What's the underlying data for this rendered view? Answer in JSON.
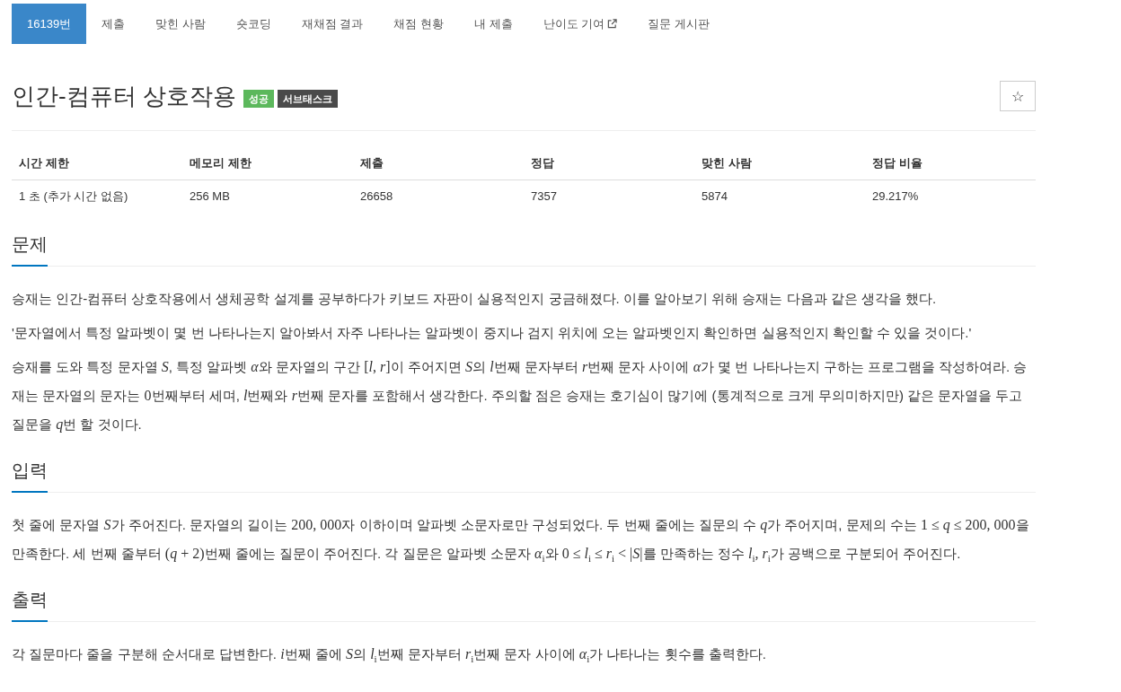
{
  "tabs": [
    {
      "label": "16139번",
      "selected": true,
      "external": false
    },
    {
      "label": "제출",
      "selected": false,
      "external": false
    },
    {
      "label": "맞힌 사람",
      "selected": false,
      "external": false
    },
    {
      "label": "숏코딩",
      "selected": false,
      "external": false
    },
    {
      "label": "재채점 결과",
      "selected": false,
      "external": false
    },
    {
      "label": "채점 현황",
      "selected": false,
      "external": false
    },
    {
      "label": "내 제출",
      "selected": false,
      "external": false
    },
    {
      "label": "난이도 기여",
      "selected": false,
      "external": true
    },
    {
      "label": "질문 게시판",
      "selected": false,
      "external": false
    }
  ],
  "title": "인간-컴퓨터 상호작용",
  "badges": [
    {
      "label": "성공",
      "kind": "success"
    },
    {
      "label": "서브태스크",
      "kind": "subtask"
    }
  ],
  "star_button": {
    "label": "☆"
  },
  "info_table": {
    "columns": [
      "시간 제한",
      "메모리 제한",
      "제출",
      "정답",
      "맞힌 사람",
      "정답 비율"
    ],
    "rows": [
      [
        "1 초 (추가 시간 없음)",
        "256 MB",
        "26658",
        "7357",
        "5874",
        "29.217%"
      ]
    ]
  },
  "sections": [
    {
      "heading": "문제",
      "paragraphs": [
        [
          {
            "kind": "text",
            "text": "승재는 인간-컴퓨터 상호작용에서 생체공학 설계를 공부하다가 키보드 자판이 실용적인지 궁금해졌다. 이를 알아보기 위해 승재는 다음과 같은 생각을 했다."
          }
        ],
        [
          {
            "kind": "text",
            "text": "'문자열에서 특정 알파벳이 몇 번 나타나는지 알아봐서 자주 나타나는 알파벳이 중지나 검지 위치에 오는 알파벳인지 확인하면 실용적인지 확인할 수 있을 것이다.'"
          }
        ],
        [
          {
            "kind": "text",
            "text": "승재를 도와 특정 문자열 "
          },
          {
            "kind": "math",
            "text": "*S*"
          },
          {
            "kind": "text",
            "text": ", 특정 알파벳 "
          },
          {
            "kind": "math",
            "text": "*α*"
          },
          {
            "kind": "text",
            "text": "와 문자열의 구간 "
          },
          {
            "kind": "math",
            "text": "[*l*, *r*]"
          },
          {
            "kind": "text",
            "text": "이 주어지면 "
          },
          {
            "kind": "math",
            "text": "*S*"
          },
          {
            "kind": "text",
            "text": "의 "
          },
          {
            "kind": "math",
            "text": "*l*"
          },
          {
            "kind": "text",
            "text": "번째 문자부터 "
          },
          {
            "kind": "math",
            "text": "*r*"
          },
          {
            "kind": "text",
            "text": "번째 문자 사이에 "
          },
          {
            "kind": "math",
            "text": "*α*"
          },
          {
            "kind": "text",
            "text": "가 몇 번 나타나는지 구하는 프로그램을 작성하여라. 승재는 문자열의 문자는 "
          },
          {
            "kind": "math",
            "text": "0"
          },
          {
            "kind": "text",
            "text": "번째부터 세며, "
          },
          {
            "kind": "math",
            "text": "*l*"
          },
          {
            "kind": "text",
            "text": "번째와 "
          },
          {
            "kind": "math",
            "text": "*r*"
          },
          {
            "kind": "text",
            "text": "번째 문자를 포함해서 생각한다. 주의할 점은 승재는 호기심이 많기에 (통계적으로 크게 무의미하지만) 같은 문자열을 두고 질문을 "
          },
          {
            "kind": "math",
            "text": "*q*"
          },
          {
            "kind": "text",
            "text": "번 할 것이다."
          }
        ]
      ]
    },
    {
      "heading": "입력",
      "paragraphs": [
        [
          {
            "kind": "text",
            "text": "첫 줄에 문자열 "
          },
          {
            "kind": "math",
            "text": "*S*"
          },
          {
            "kind": "text",
            "text": "가 주어진다. 문자열의 길이는 "
          },
          {
            "kind": "math",
            "text": "200, 000"
          },
          {
            "kind": "text",
            "text": "자 이하이며 알파벳 소문자로만 구성되었다. 두 번째 줄에는 질문의 수 "
          },
          {
            "kind": "math",
            "text": "*q*"
          },
          {
            "kind": "text",
            "text": "가 주어지며, 문제의 수는 "
          },
          {
            "kind": "math",
            "text": "1 ≤ *q* ≤ 200, 000"
          },
          {
            "kind": "text",
            "text": "을 만족한다. 세 번째 줄부터 "
          },
          {
            "kind": "math",
            "text": "(*q* + 2)"
          },
          {
            "kind": "text",
            "text": "번째 줄에는 질문이 주어진다. 각 질문은 알파벳 소문자 "
          },
          {
            "kind": "math",
            "text": "*α*$_{i}$"
          },
          {
            "kind": "text",
            "text": "와 "
          },
          {
            "kind": "math",
            "text": "0 ≤ *l*$_{i}$ ≤ *r*$_{i}$ < |*S*|"
          },
          {
            "kind": "text",
            "text": "를 만족하는 정수 "
          },
          {
            "kind": "math",
            "text": "*l*$_{i}$, *r*$_{i}$"
          },
          {
            "kind": "text",
            "text": "가 공백으로 구분되어 주어진다."
          }
        ]
      ]
    },
    {
      "heading": "출력",
      "paragraphs": [
        [
          {
            "kind": "text",
            "text": "각 질문마다 줄을 구분해 순서대로 답변한다. "
          },
          {
            "kind": "math",
            "text": "*i*"
          },
          {
            "kind": "text",
            "text": "번째 줄에 "
          },
          {
            "kind": "math",
            "text": "*S*"
          },
          {
            "kind": "text",
            "text": "의 "
          },
          {
            "kind": "math",
            "text": "*l*$_{i}$"
          },
          {
            "kind": "text",
            "text": "번째 문자부터 "
          },
          {
            "kind": "math",
            "text": "*r*$_{i}$"
          },
          {
            "kind": "text",
            "text": "번째 문자 사이에 "
          },
          {
            "kind": "math",
            "text": "*α*$_{i}$"
          },
          {
            "kind": "text",
            "text": "가 나타나는 횟수를 출력한다."
          }
        ]
      ]
    }
  ]
}
